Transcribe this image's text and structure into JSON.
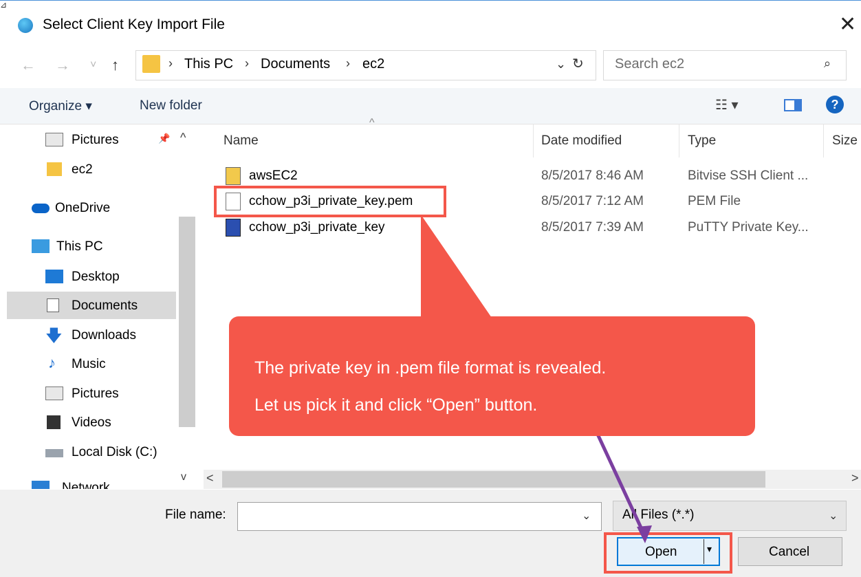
{
  "window": {
    "title": "Select Client Key Import File",
    "close_glyph": "✕",
    "corner_glyph": "⊿"
  },
  "nav": {
    "back": "←",
    "forward": "→",
    "recent": "˅",
    "up": "↑"
  },
  "address": {
    "crumbs": [
      "This PC",
      "Documents",
      "ec2"
    ],
    "separator": "›",
    "dropdown": "⌄",
    "refresh": "↻"
  },
  "search": {
    "placeholder": "Search ec2",
    "icon": "⌕"
  },
  "toolbar": {
    "organize": "Organize ▾",
    "new_folder": "New folder",
    "view_glyph": "☷ ▾",
    "help_glyph": "?"
  },
  "sidebar": {
    "items": [
      {
        "label": "Pictures",
        "icon": "pictures-icon",
        "pinned": true
      },
      {
        "label": "ec2",
        "icon": "folder-icon"
      },
      {
        "label": "OneDrive",
        "icon": "cloud-icon"
      },
      {
        "label": "This PC",
        "icon": "monitor-icon"
      },
      {
        "label": "Desktop",
        "icon": "desktop-icon"
      },
      {
        "label": "Documents",
        "icon": "documents-icon",
        "selected": true
      },
      {
        "label": "Downloads",
        "icon": "download-icon"
      },
      {
        "label": "Music",
        "icon": "music-icon"
      },
      {
        "label": "Pictures",
        "icon": "pictures-icon"
      },
      {
        "label": "Videos",
        "icon": "videos-icon"
      },
      {
        "label": "Local Disk (C:)",
        "icon": "disk-icon"
      },
      {
        "label": "Network",
        "icon": "network-icon"
      }
    ],
    "pin_glyph": "📌",
    "scroll_up": "^",
    "scroll_down": "v"
  },
  "columns": {
    "name": "Name",
    "date": "Date modified",
    "type": "Type",
    "size": "Size",
    "sort_glyph": "^"
  },
  "files": [
    {
      "name": "awsEC2",
      "date": "8/5/2017 8:46 AM",
      "type": "Bitvise SSH Client ...",
      "icon": "bitvise-icon"
    },
    {
      "name": "cchow_p3i_private_key.pem",
      "date": "8/5/2017 7:12 AM",
      "type": "PEM File",
      "icon": "file-icon"
    },
    {
      "name": "cchow_p3i_private_key",
      "date": "8/5/2017 7:39 AM",
      "type": "PuTTY Private Key...",
      "icon": "putty-icon"
    }
  ],
  "hscroll": {
    "left": "<",
    "right": ">"
  },
  "bottom": {
    "file_name_label": "File name:",
    "file_name_value": "",
    "filter_value": "All Files (*.*)",
    "dropdown_glyph": "⌄",
    "open_label": "Open",
    "open_dd": "▾",
    "cancel_label": "Cancel"
  },
  "callout": {
    "line1": "The private key in .pem file format is revealed.",
    "line2": "Let us pick it and click “Open” button."
  },
  "colors": {
    "accent": "#0078d7",
    "callout": "#f4574a",
    "arrow": "#7b3fa0"
  }
}
